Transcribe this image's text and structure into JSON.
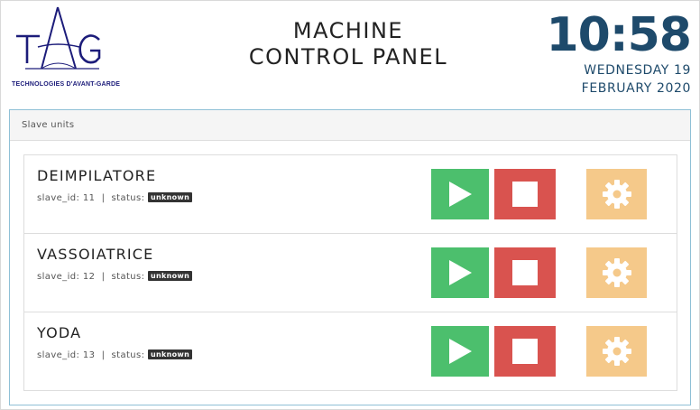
{
  "header": {
    "logo_text": "TAG",
    "logo_tagline": "TECHNOLOGIES D'AVANT-GARDE",
    "title_line1": "MACHINE",
    "title_line2": "CONTROL PANEL",
    "time": "10:58",
    "date_line1": "WEDNESDAY 19",
    "date_line2": "FEBRUARY 2020"
  },
  "panel": {
    "title": "Slave units"
  },
  "units": [
    {
      "name": "DEIMPILATORE",
      "slave_id_label": "slave_id:",
      "slave_id": "11",
      "status_label": "status:",
      "status": "unknown"
    },
    {
      "name": "VASSOIATRICE",
      "slave_id_label": "slave_id:",
      "slave_id": "12",
      "status_label": "status:",
      "status": "unknown"
    },
    {
      "name": "YODA",
      "slave_id_label": "slave_id:",
      "slave_id": "13",
      "status_label": "status:",
      "status": "unknown"
    }
  ],
  "icons": {
    "play": "play-icon",
    "stop": "stop-icon",
    "settings": "gear-icon"
  },
  "colors": {
    "play": "#4cbf6d",
    "stop": "#d9534f",
    "settings": "#f5c98a",
    "clock": "#1e4a6b",
    "logo": "#1c1c7a"
  }
}
